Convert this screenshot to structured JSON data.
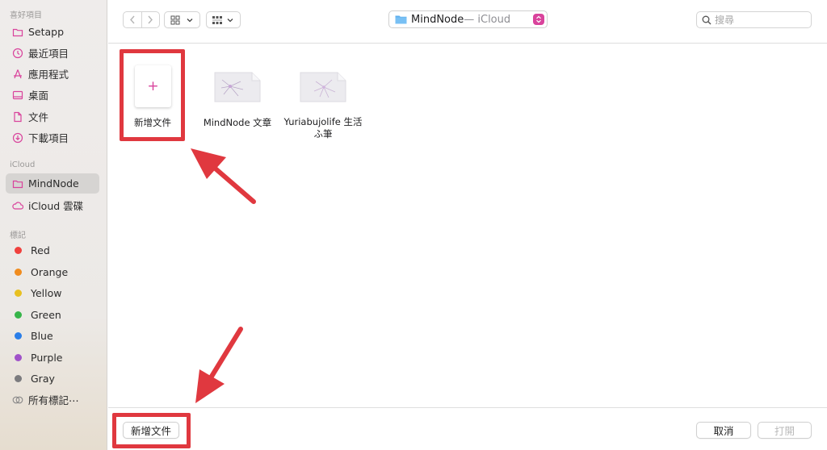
{
  "sidebar": {
    "favorites_header": "喜好項目",
    "favorites": [
      {
        "label": "Setapp",
        "icon": "folder-icon"
      },
      {
        "label": "最近項目",
        "icon": "clock-icon"
      },
      {
        "label": "應用程式",
        "icon": "applications-icon"
      },
      {
        "label": "桌面",
        "icon": "desktop-icon"
      },
      {
        "label": "文件",
        "icon": "document-icon"
      },
      {
        "label": "下載項目",
        "icon": "download-icon"
      }
    ],
    "icloud_header": "iCloud",
    "icloud": [
      {
        "label": "MindNode",
        "icon": "folder-icon",
        "selected": true
      },
      {
        "label": "iCloud 雲碟",
        "icon": "cloud-icon"
      }
    ],
    "tags_header": "標記",
    "tags": [
      {
        "label": "Red",
        "color": "#f0413d"
      },
      {
        "label": "Orange",
        "color": "#f08c1e"
      },
      {
        "label": "Yellow",
        "color": "#e8c020"
      },
      {
        "label": "Green",
        "color": "#37b54a"
      },
      {
        "label": "Blue",
        "color": "#2a7ee8"
      },
      {
        "label": "Purple",
        "color": "#a052c9"
      },
      {
        "label": "Gray",
        "color": "#7b7b7e"
      }
    ],
    "all_tags": "所有標記⋯"
  },
  "toolbar": {
    "location_name": "MindNode",
    "location_sub": " — iCloud",
    "search_placeholder": "搜尋"
  },
  "files": [
    {
      "label": "新增文件",
      "type": "new-document"
    },
    {
      "label": "MindNode 文章",
      "type": "mindnode-document"
    },
    {
      "label_line1": "Yuriabujolife 生活",
      "label_line2": "ふ筆",
      "type": "mindnode-document"
    }
  ],
  "bottom": {
    "new_document_button": "新增文件",
    "cancel_button": "取消",
    "open_button": "打開"
  },
  "colors": {
    "accent": "#d9439c",
    "annotation": "#e0383f"
  }
}
